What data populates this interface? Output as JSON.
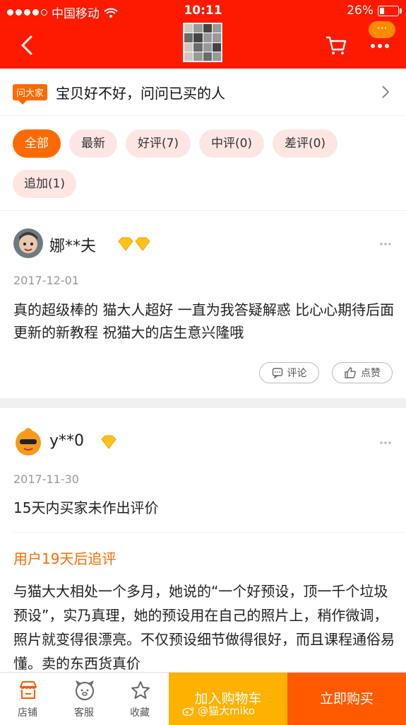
{
  "status_bar": {
    "carrier": "中国移动",
    "time": "10:11",
    "battery": "26%",
    "battery_level": 0.26
  },
  "nav": {
    "back_icon": "chevron-left-icon",
    "cart_icon": "cart-icon",
    "more_icon": "more-icon",
    "more_badge": "···"
  },
  "ask": {
    "tag": "问大家",
    "text": "宝贝好不好，问问已买的人"
  },
  "filters": [
    {
      "label": "全部",
      "active": true
    },
    {
      "label": "最新",
      "active": false
    },
    {
      "label": "好评(7)",
      "active": false
    },
    {
      "label": "中评(0)",
      "active": false
    },
    {
      "label": "差评(0)",
      "active": false
    },
    {
      "label": "追加(1)",
      "active": false
    }
  ],
  "reviews": [
    {
      "username": "娜**夫",
      "date": "2017-12-01",
      "content": "真的超级棒的 猫大人超好 一直为我答疑解惑 比心心期待后面更新的新教程 祝猫大的店生意兴隆哦",
      "comment_label": "评论",
      "like_label": "点赞"
    },
    {
      "username": "y**0",
      "date": "2017-11-30",
      "content": "15天内买家未作出评价",
      "append_title": "用户19天后追评",
      "append_content": "与猫大大相处一个多月，她说的“一个好预设，顶一千个垃圾预设”，实乃真理，她的预设用在自己的照片上，稍作微调，照片就变得很漂亮。不仅预设细节做得很好，而且课程通俗易懂。卖的东西货真价"
    }
  ],
  "bottom_bar": {
    "shop_label": "店铺",
    "service_label": "客服",
    "favorite_label": "收藏",
    "add_cart_label": "加入购物车",
    "buy_now_label": "立即购买",
    "watermark": "@猫大miko"
  },
  "colors": {
    "brand_red": "#fd1a00",
    "accent_orange": "#ff6a00",
    "cart_yellow": "#ffb100",
    "buy_orange": "#ff5a00"
  }
}
